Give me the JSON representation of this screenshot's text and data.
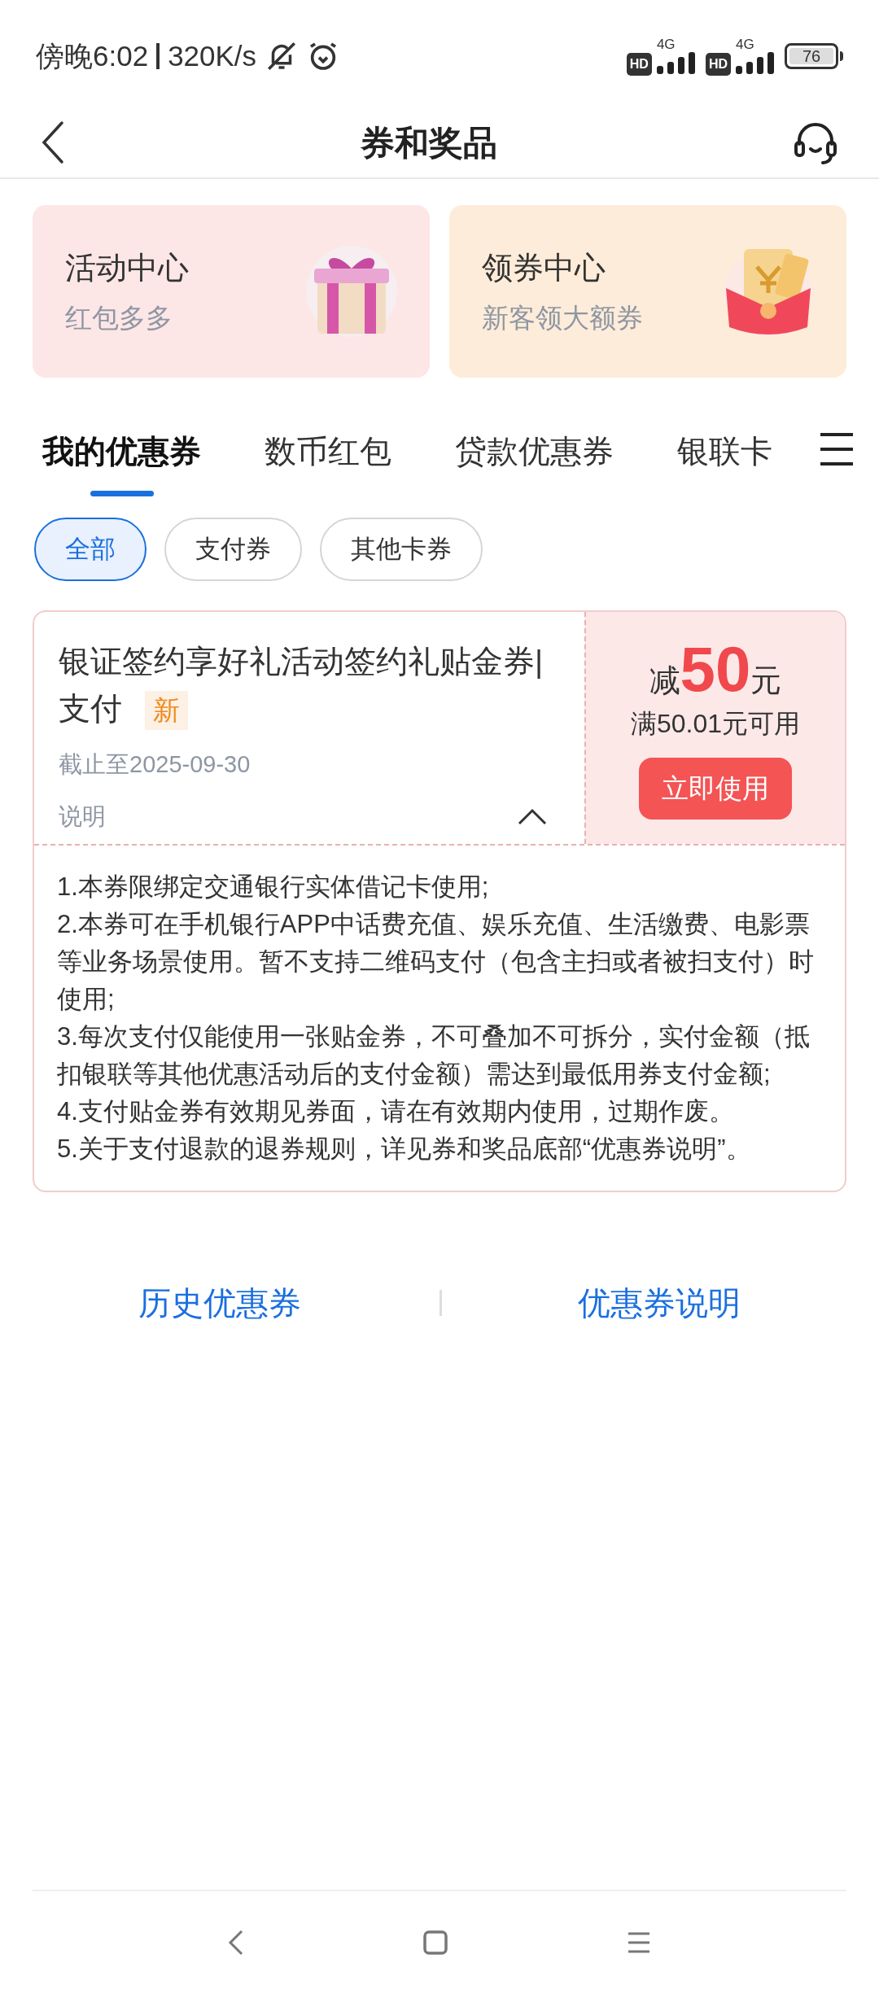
{
  "status_bar": {
    "time": "傍晚6:02",
    "speed": "320K/s",
    "sim_badges": [
      "HD",
      "HD"
    ],
    "network": [
      "4G",
      "4G"
    ],
    "battery": "76"
  },
  "header": {
    "title": "券和奖品"
  },
  "promo_cards": [
    {
      "title": "活动中心",
      "subtitle": "红包多多",
      "kind": "gift"
    },
    {
      "title": "领券中心",
      "subtitle": "新客领大额券",
      "kind": "envelope"
    }
  ],
  "tabs": [
    {
      "label": "我的优惠券",
      "selected": true
    },
    {
      "label": "数币红包",
      "selected": false
    },
    {
      "label": "贷款优惠券",
      "selected": false
    },
    {
      "label": "银联卡",
      "selected": false
    }
  ],
  "filters": [
    {
      "label": "全部",
      "selected": true
    },
    {
      "label": "支付券",
      "selected": false
    },
    {
      "label": "其他卡券",
      "selected": false
    }
  ],
  "coupon": {
    "title": "银证签约享好礼活动签约礼贴金券|支付",
    "badge": "新",
    "expiry": "截止至2025-09-30",
    "notes_label": "说明",
    "expanded": true,
    "amount_prefix": "减",
    "amount": "50",
    "amount_unit": "元",
    "condition": "满50.01元可用",
    "action": "立即使用",
    "notes": [
      "1.本券限绑定交通银行实体借记卡使用;",
      "2.本券可在手机银行APP中话费充值、娱乐充值、生活缴费、电影票等业务场景使用。暂不支持二维码支付（包含主扫或者被扫支付）时使用;",
      "3.每次支付仅能使用一张贴金券，不可叠加不可拆分，实付金额（抵扣银联等其他优惠活动后的支付金额）需达到最低用券支付金额;",
      "4.支付贴金券有效期见券面，请在有效期内使用，过期作废。",
      "5.关于支付退款的退券规则，详见券和奖品底部“优惠券说明”。"
    ]
  },
  "footer_links": [
    "历史优惠券",
    "优惠券说明"
  ]
}
